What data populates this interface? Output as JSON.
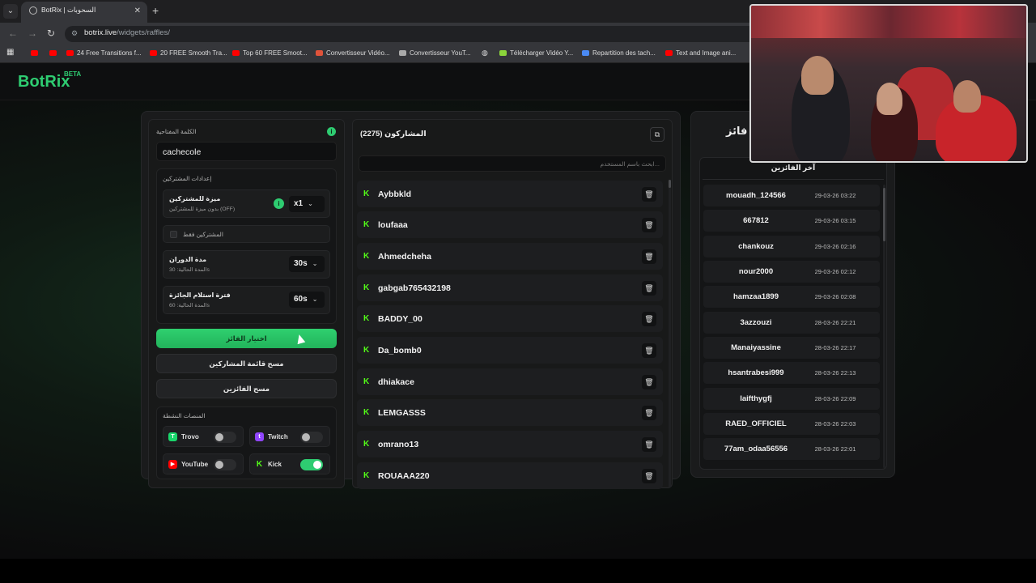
{
  "browser": {
    "tab_title": "BotRix | السحوبات",
    "url_host": "botrix.live",
    "url_path": "/widgets/raffles/",
    "bookmarks": [
      "24 Free Transitions f...",
      "20 FREE Smooth Tra...",
      "Top 60 FREE Smoot...",
      "Convertisseur Vidéo...",
      "Convertisseur YouT...",
      "Télécharger Vidéo Y...",
      "Repartition des tach...",
      "Text and Image ani..."
    ]
  },
  "header": {
    "logo": "BotRix",
    "badge": "BETA"
  },
  "settings": {
    "keyword_label": "الكلمة المفتاحية",
    "keyword_value": "cachecole",
    "participants_settings_label": "إعدادات المشتركين",
    "subscriber_bonus_title": "ميزة للمشتركين",
    "subscriber_bonus_sub": "بدون ميزة للمشتركين (OFF)",
    "subscriber_bonus_value": "x1",
    "subscribers_only_label": "المشتركين فقط",
    "spin_duration_title": "مدة الدوران",
    "spin_duration_sub": "المدة الحالية: 30s",
    "spin_duration_value": "30s",
    "claim_period_title": "فترة استلام الجائزة",
    "claim_period_sub": "المدة الحالية: 60s",
    "claim_period_value": "60s",
    "pick_winner_label": "اختيار الفائز",
    "clear_participants_label": "مسح قائمة المشاركين",
    "clear_winners_label": "مسح الفائزين",
    "active_platforms_label": "المنصات النشطة",
    "platforms": [
      {
        "name": "Trovo",
        "enabled": false,
        "color": "#19d66b"
      },
      {
        "name": "Twitch",
        "enabled": false,
        "color": "#9146ff"
      },
      {
        "name": "YouTube",
        "enabled": false,
        "color": "#ff0000"
      },
      {
        "name": "Kick",
        "enabled": true,
        "color": "#53fc18"
      }
    ]
  },
  "participants": {
    "title": "المشاركون (2275)",
    "search_placeholder": "ابحث باسم المستخدم...",
    "list": [
      "Aybbkld",
      "loufaaa",
      "Ahmedcheha",
      "gabgab765432198",
      "BADDY_00",
      "Da_bomb0",
      "dhiakace",
      "LEMGASSS",
      "omrano13",
      "ROUAAA220"
    ]
  },
  "winners": {
    "title": "فائز",
    "subtitle": "آخر الفائزين",
    "list": [
      {
        "name": "mouadh_124566",
        "time": "29-03-26 03:22"
      },
      {
        "name": "667812",
        "time": "29-03-26 03:15"
      },
      {
        "name": "chankouz",
        "time": "29-03-26 02:16"
      },
      {
        "name": "nour2000",
        "time": "29-03-26 02:12"
      },
      {
        "name": "hamzaa1899",
        "time": "29-03-26 02:08"
      },
      {
        "name": "3azzouzi",
        "time": "28-03-26 22:21"
      },
      {
        "name": "Manaiyassine",
        "time": "28-03-26 22:17"
      },
      {
        "name": "hsantrabesi999",
        "time": "28-03-26 22:13"
      },
      {
        "name": "laifthygfj",
        "time": "28-03-26 22:09"
      },
      {
        "name": "RAED_OFFICIEL",
        "time": "28-03-26 22:03"
      },
      {
        "name": "77am_odaa56556",
        "time": "28-03-26 22:01"
      }
    ]
  },
  "colors": {
    "accent": "#2ecc71",
    "kick": "#53fc18"
  }
}
